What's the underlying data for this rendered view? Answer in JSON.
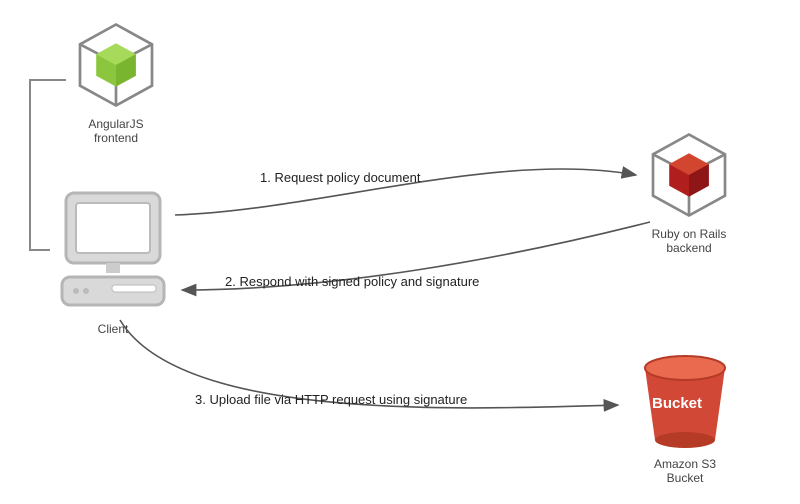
{
  "nodes": {
    "angular": {
      "label": "AngularJS\nfrontend",
      "color": "#8cc63f"
    },
    "client": {
      "label": "Client"
    },
    "rails": {
      "label": "Ruby on Rails\nbackend",
      "color": "#b01e1e"
    },
    "s3": {
      "label": "Amazon S3\nBucket",
      "bucket_text": "Bucket",
      "color": "#d14836"
    }
  },
  "steps": {
    "s1": "1. Request policy document",
    "s2": "2. Respond with signed policy and signature",
    "s3": "3. Upload file via HTTP request using signature"
  }
}
